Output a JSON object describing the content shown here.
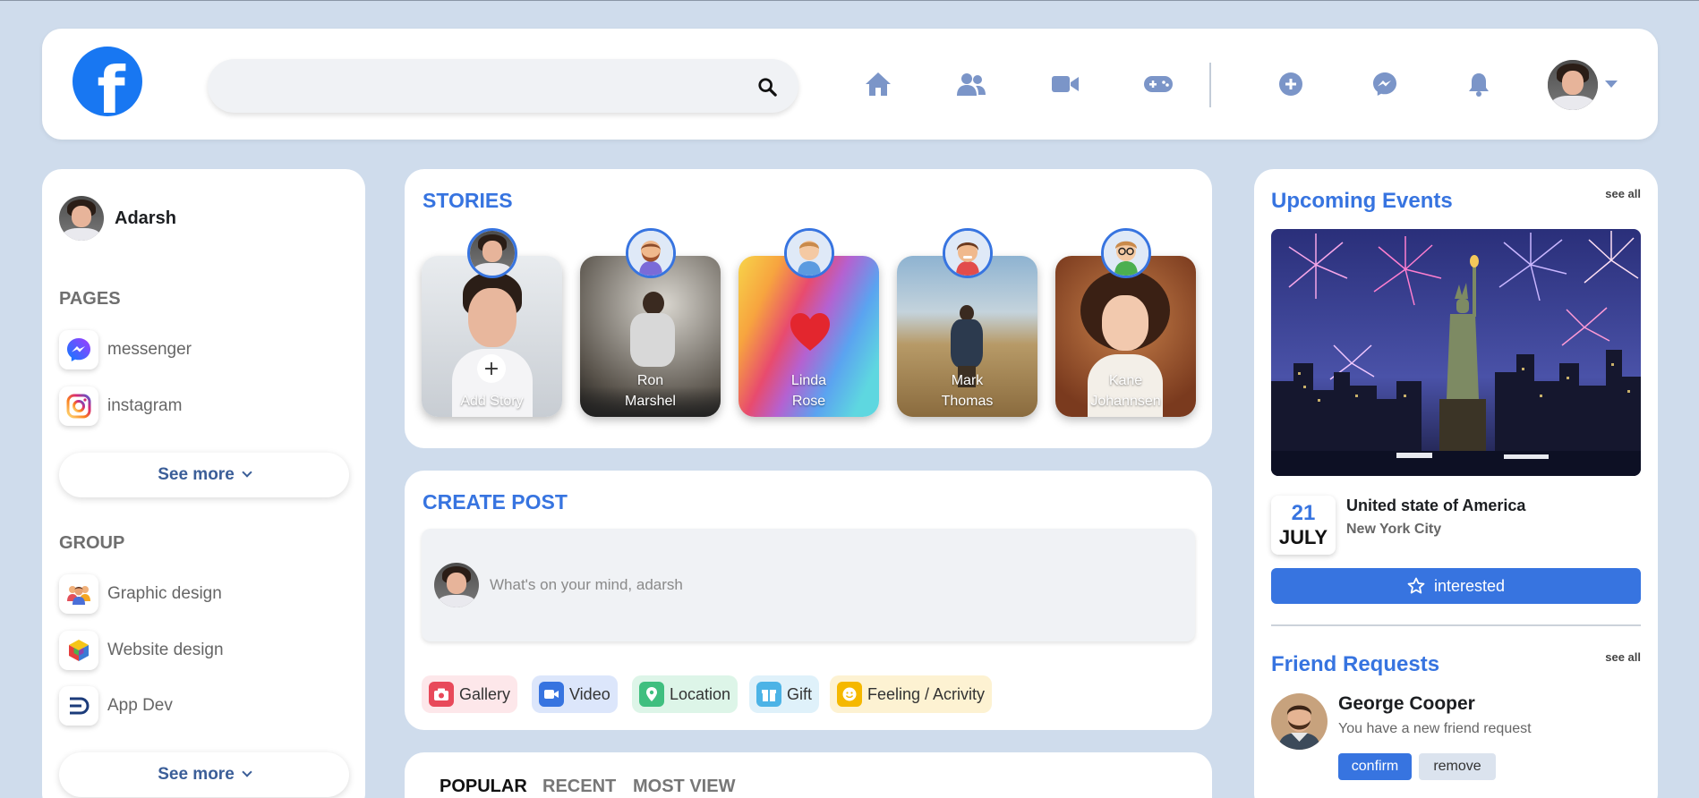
{
  "colors": {
    "page_bg": "#cfdcec",
    "accent": "#3774e0",
    "brand": "#1877f2",
    "nav_icon": "#7b95c8"
  },
  "header": {
    "logo_letter": "f",
    "search": {
      "placeholder": "",
      "icon": "search-icon"
    },
    "nav_icons": [
      "home-icon",
      "friends-icon",
      "video-icon",
      "gaming-icon"
    ],
    "action_icons": [
      "add-icon",
      "messenger-icon",
      "bell-icon"
    ]
  },
  "sidebar": {
    "user_name": "Adarsh",
    "pages_heading": "PAGES",
    "pages": [
      {
        "label": "messenger",
        "icon": "messenger-icon"
      },
      {
        "label": "instagram",
        "icon": "instagram-icon"
      }
    ],
    "see_more_1": "See more",
    "group_heading": "GROUP",
    "groups": [
      {
        "label": "Graphic design",
        "icon": "people-icon"
      },
      {
        "label": "Website design",
        "icon": "cube-icon"
      },
      {
        "label": "App Dev",
        "icon": "appdev-icon"
      }
    ],
    "see_more_2": "See more"
  },
  "stories": {
    "title": "STORIES",
    "items": [
      {
        "line1": "Add Story",
        "line2": ""
      },
      {
        "line1": "Ron",
        "line2": "Marshel"
      },
      {
        "line1": "Linda",
        "line2": "Rose"
      },
      {
        "line1": "Mark",
        "line2": "Thomas"
      },
      {
        "line1": "Kane",
        "line2": "Johannsen"
      }
    ]
  },
  "create_post": {
    "title": "CREATE POST",
    "placeholder": "What's on your mind, adarsh",
    "actions": [
      {
        "label": "Gallery",
        "icon": "camera-icon",
        "color": "#e8495a"
      },
      {
        "label": "Video",
        "icon": "video-icon",
        "color": "#3774e0"
      },
      {
        "label": "Location",
        "icon": "location-icon",
        "color": "#3fbf7f"
      },
      {
        "label": "Gift",
        "icon": "gift-icon",
        "color": "#4cb3e6"
      },
      {
        "label": "Feeling / Acrivity",
        "icon": "smile-icon",
        "color": "#f5b800"
      }
    ]
  },
  "feed_tabs": [
    "POPULAR",
    "RECENT",
    "MOST VIEW"
  ],
  "events": {
    "title": "Upcoming Events",
    "see_all": "see all",
    "day": "21",
    "month": "JULY",
    "event_title": "United state of America",
    "event_location": "New York City",
    "interested_label": "interested"
  },
  "friend_requests": {
    "title": "Friend Requests",
    "see_all": "see all",
    "name": "George Cooper",
    "message": "You have a new friend request",
    "confirm_label": "confirm",
    "remove_label": "remove"
  }
}
